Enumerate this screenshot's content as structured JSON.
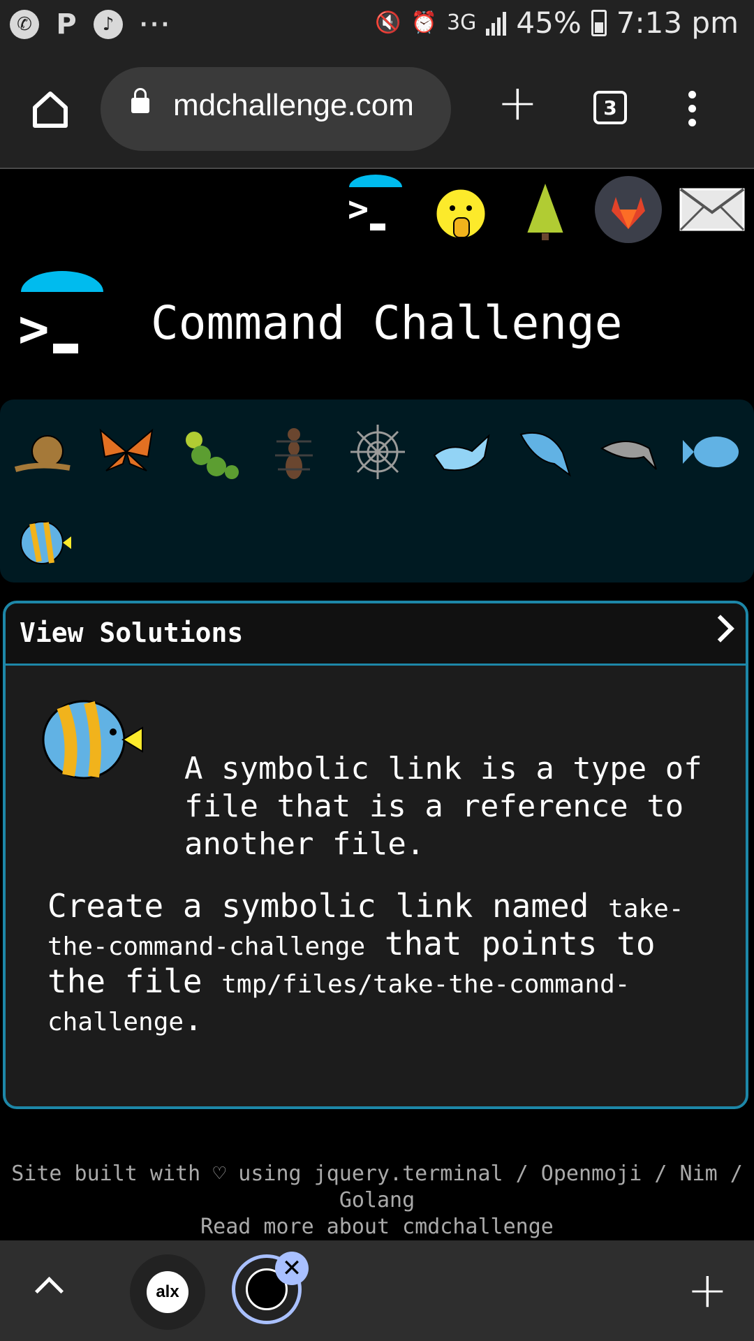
{
  "status_bar": {
    "left_icons": [
      "whatsapp-icon",
      "p-icon",
      "music-icon",
      "more-icon"
    ],
    "network": "3G",
    "battery_percent": "45%",
    "time": "7:13 pm"
  },
  "browser": {
    "url": "mdchallenge.com",
    "tab_count": "3"
  },
  "page": {
    "title": "Command Challenge",
    "header_icons": [
      "terminal-logo-icon",
      "shushing-face-icon",
      "tree-icon",
      "gitlab-icon",
      "mail-icon"
    ],
    "levels": [
      "snail-icon",
      "butterfly-icon",
      "caterpillar-icon",
      "ant-icon",
      "spiderweb-icon",
      "whale-icon",
      "whale2-icon",
      "dolphin-icon",
      "fish-icon",
      "tropical-fish-icon"
    ],
    "solutions": {
      "title": "View Solutions",
      "intro": "A symbolic link is a type of file that is a reference to another file.",
      "task_part1": "Create a symbolic link named ",
      "task_code1": "take-the-command-challenge",
      "task_part2": " that points to the file ",
      "task_code2": "tmp/files/take-the-command-challenge",
      "task_part3": "."
    },
    "footer": {
      "line1": "Site built with ♡ using jquery.terminal / Openmoji / Nim / Golang",
      "line2": "Read more about cmdchallenge"
    }
  },
  "bottom_bar": {
    "tab1_label": "alx"
  },
  "colors": {
    "accent": "#00bbee",
    "border": "#1d87a8",
    "levels_bg": "#001a22"
  }
}
